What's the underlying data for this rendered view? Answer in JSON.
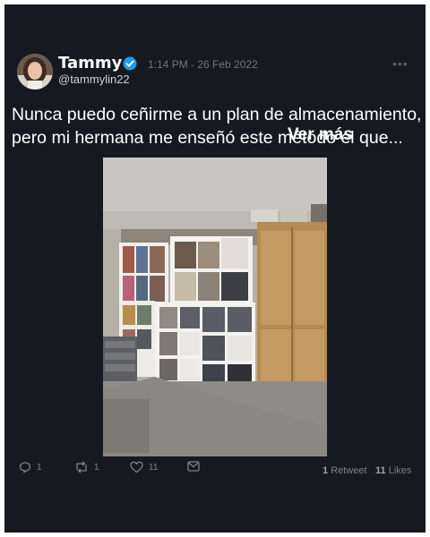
{
  "tweet": {
    "author_name": "Tammy",
    "handle": "@tammylin22",
    "timestamp": "1:14 PM - 26 Feb 2022",
    "more_label": "•••",
    "text": "Nunca puedo ceñirme a un plan de almacenamiento, pero mi hermana me enseñó este método el que...",
    "see_more": "Ver más",
    "verified_color": "#1d9bf0"
  },
  "actions": {
    "reply_count": "1",
    "retweet_count": "1",
    "like_count": "11"
  },
  "stats": {
    "retweets_num": "1",
    "retweets_label": "Retweet",
    "likes_num": "11",
    "likes_label": "Likes"
  }
}
